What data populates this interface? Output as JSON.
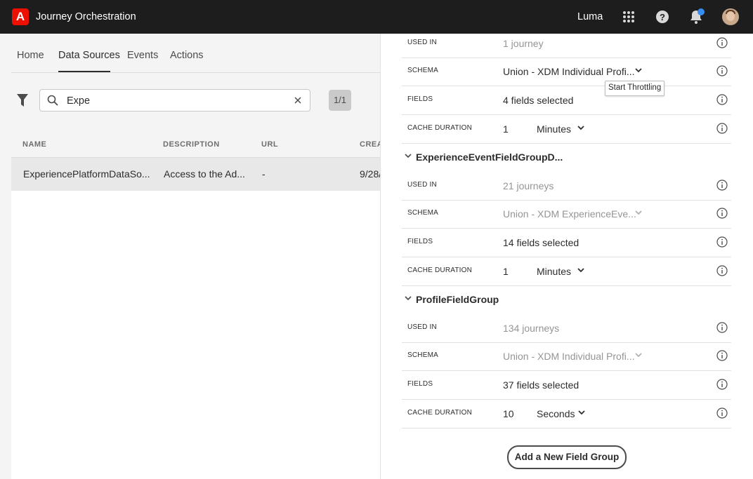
{
  "header": {
    "app_title": "Journey Orchestration",
    "org_name": "Luma",
    "logo_letter": "A",
    "icons": [
      "apps-grid-icon",
      "help-icon",
      "notification-bell-icon"
    ],
    "notification_dot_color": "#378ef0"
  },
  "tabs": [
    {
      "label": "Home"
    },
    {
      "label": "Data Sources",
      "active": true
    },
    {
      "label": "Events"
    },
    {
      "label": "Actions"
    }
  ],
  "search": {
    "value": "Expe",
    "placeholder": ""
  },
  "pager": "1/1",
  "table": {
    "columns": [
      "NAME",
      "DESCRIPTION",
      "URL",
      "CREAT"
    ],
    "rows": [
      {
        "name": "ExperiencePlatformDataSo...",
        "description": "Access to the Ad...",
        "url": "-",
        "created": "9/28/"
      }
    ]
  },
  "panel": {
    "top_rows": [
      {
        "label": "USED IN",
        "value": "1 journey"
      },
      {
        "label": "SCHEMA",
        "value": "Union - XDM Individual Profi..."
      },
      {
        "label": "FIELDS",
        "value": "4 fields selected"
      },
      {
        "label": "CACHE DURATION",
        "value": "1",
        "unit": "Minutes"
      }
    ],
    "groups": [
      {
        "title": "ExperienceEventFieldGroupD...",
        "rows": [
          {
            "label": "USED IN",
            "value": "21 journeys"
          },
          {
            "label": "SCHEMA",
            "value": "Union - XDM ExperienceEve..."
          },
          {
            "label": "FIELDS",
            "value": "14 fields selected"
          },
          {
            "label": "CACHE DURATION",
            "value": "1",
            "unit": "Minutes"
          }
        ]
      },
      {
        "title": "ProfileFieldGroup",
        "rows": [
          {
            "label": "USED IN",
            "value": "134 journeys"
          },
          {
            "label": "SCHEMA",
            "value": "Union - XDM Individual Profi..."
          },
          {
            "label": "FIELDS",
            "value": "37 fields selected"
          },
          {
            "label": "CACHE DURATION",
            "value": "10",
            "unit": "Seconds"
          }
        ]
      }
    ],
    "add_button": "Add a New Field Group"
  },
  "tooltip": "Start Throttling"
}
